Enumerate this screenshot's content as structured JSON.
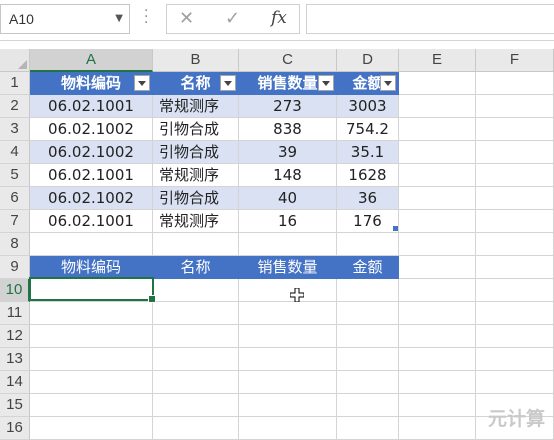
{
  "name_box": {
    "value": "A10"
  },
  "formula_bar": {
    "cancel": "✕",
    "enter": "✓",
    "fx": "fx",
    "content": ""
  },
  "columns": [
    "A",
    "B",
    "C",
    "D",
    "E",
    "F"
  ],
  "rows": [
    "1",
    "2",
    "3",
    "4",
    "5",
    "6",
    "7",
    "8",
    "9",
    "10",
    "11",
    "12",
    "13",
    "14",
    "15",
    "16"
  ],
  "table": {
    "headers": [
      "物料编码",
      "名称",
      "销售数量",
      "金额"
    ],
    "rows": [
      [
        "06.02.1001",
        "常规测序",
        "273",
        "3003"
      ],
      [
        "06.02.1002",
        "引物合成",
        "838",
        "754.2"
      ],
      [
        "06.02.1002",
        "引物合成",
        "39",
        "35.1"
      ],
      [
        "06.02.1001",
        "常规测序",
        "148",
        "1628"
      ],
      [
        "06.02.1002",
        "引物合成",
        "40",
        "36"
      ],
      [
        "06.02.1001",
        "常规测序",
        "16",
        "176"
      ]
    ],
    "header_color": "#4472c4",
    "band_color": "#d9e1f2"
  },
  "criteria_headers": [
    "物料编码",
    "名称",
    "销售数量",
    "金额"
  ],
  "selected_cell": "A10",
  "watermark": "元计算"
}
